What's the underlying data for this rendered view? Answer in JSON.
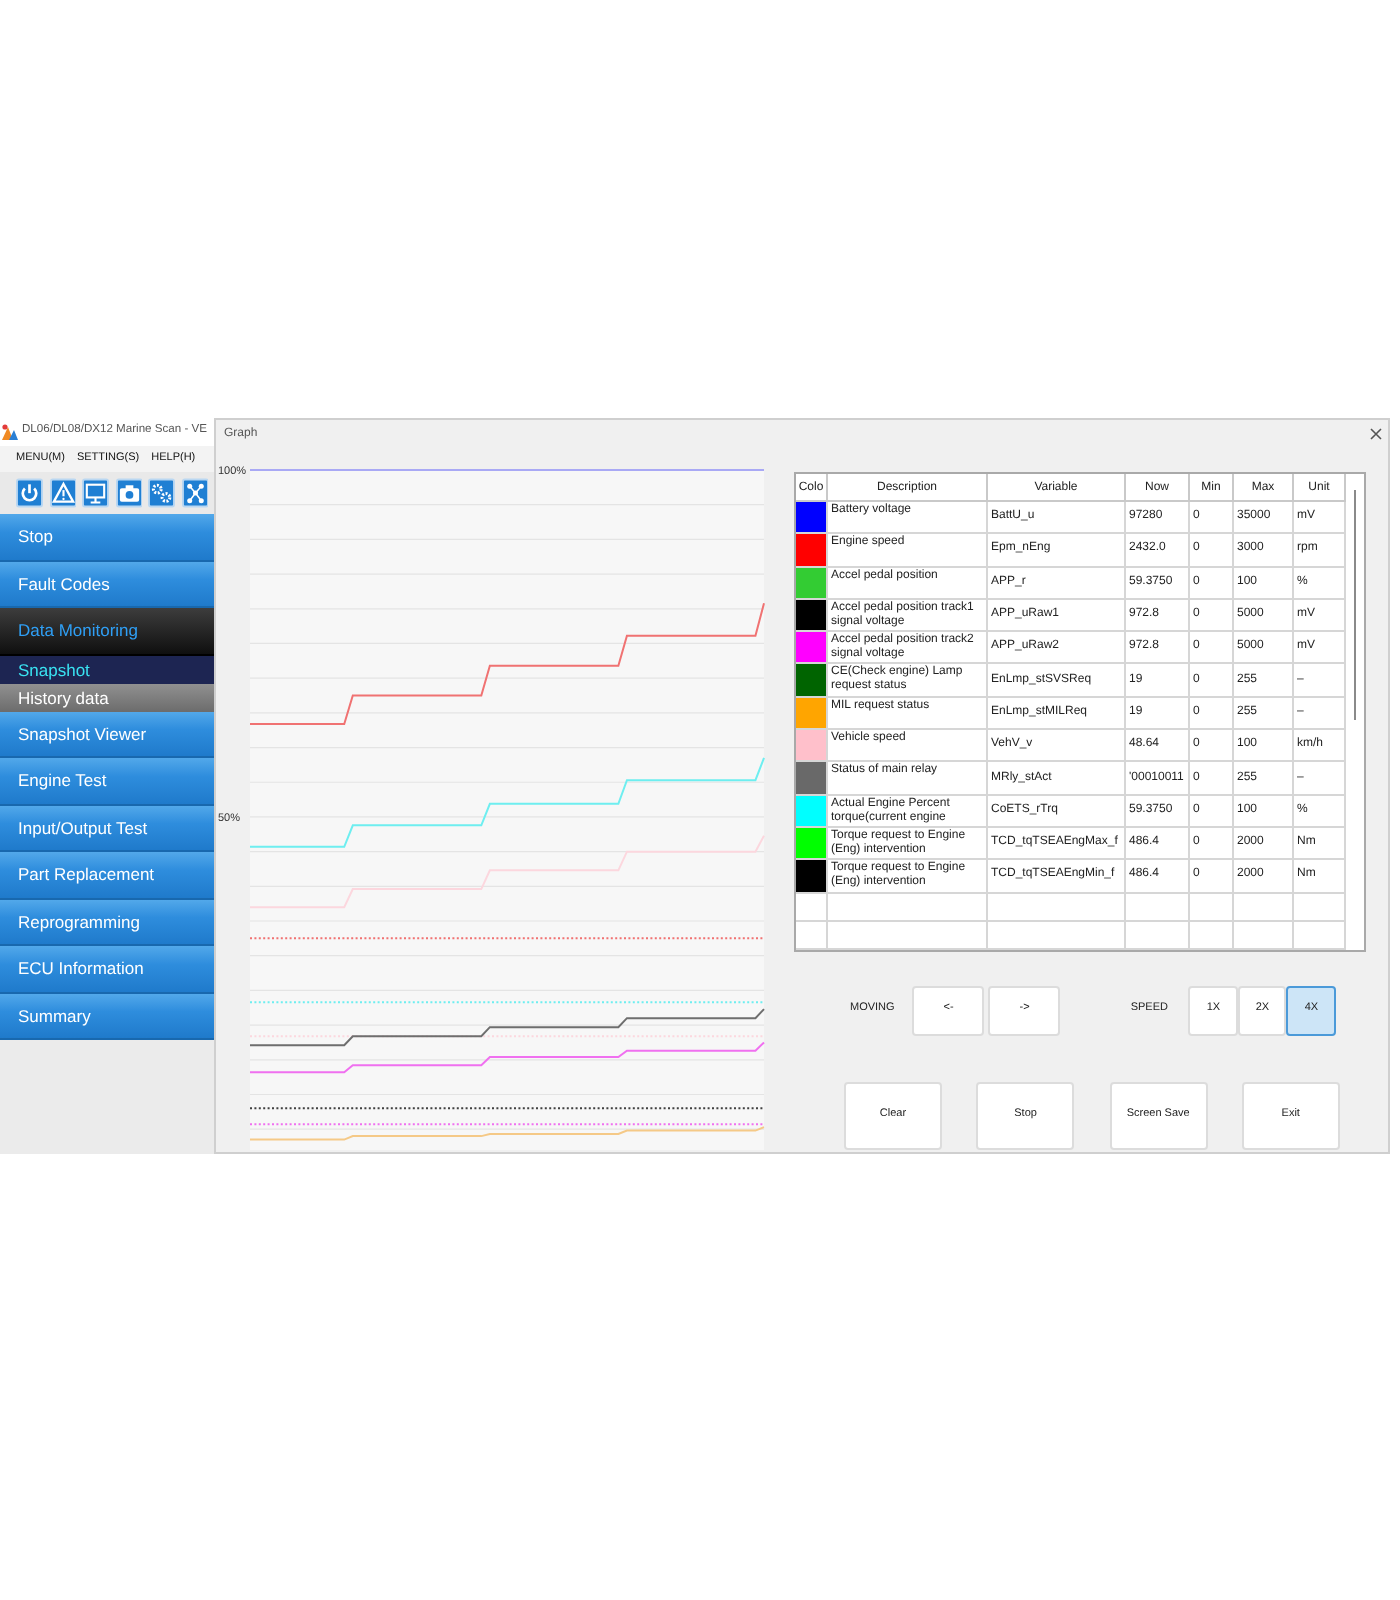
{
  "main_window": {
    "title": "DL06/DL08/DX12 Marine Scan - VE",
    "menu": [
      "MENU(M)",
      "SETTING(S)",
      "HELP(H)"
    ]
  },
  "sidebar": {
    "items": [
      {
        "label": "Stop",
        "selected": false
      },
      {
        "label": "Fault Codes",
        "selected": false
      },
      {
        "label": "Data Monitoring",
        "selected": true,
        "children": [
          {
            "label": "Snapshot",
            "selected": true
          },
          {
            "label": "History data",
            "selected": false
          }
        ]
      },
      {
        "label": "Snapshot Viewer",
        "selected": false
      },
      {
        "label": "Engine Test",
        "selected": false
      },
      {
        "label": "Input/Output Test",
        "selected": false
      },
      {
        "label": "Part Replacement",
        "selected": false
      },
      {
        "label": "Reprogramming",
        "selected": false
      },
      {
        "label": "ECU Information",
        "selected": false
      },
      {
        "label": "Summary",
        "selected": false
      }
    ]
  },
  "graph_window": {
    "title": "Graph"
  },
  "chart": {
    "chart_data": {
      "type": "line",
      "categories": [
        null,
        null,
        null,
        null,
        null,
        null,
        null,
        null,
        null,
        null,
        null,
        null,
        null,
        null,
        null,
        null,
        null,
        null,
        null,
        null,
        null,
        null,
        null,
        null,
        null,
        null,
        null,
        null,
        null,
        null,
        null,
        null,
        null,
        null,
        null,
        null,
        null,
        null,
        null,
        null,
        null,
        null,
        null,
        null,
        null,
        null,
        null,
        null,
        null,
        null,
        null,
        null,
        null,
        null,
        null,
        null,
        null,
        null,
        null,
        null,
        null
      ],
      "ylim": [
        2,
        100
      ],
      "yticks": [
        {
          "value": 50,
          "label": "50%"
        },
        {
          "value": 100,
          "label": "100%"
        }
      ],
      "series": [
        {
          "color": "#a9a9f5",
          "line_style": "solid",
          "values": [
            100,
            100,
            100,
            100,
            100,
            100,
            100,
            100,
            100,
            100,
            100,
            100,
            100,
            100,
            100,
            100,
            100,
            100,
            100,
            100,
            100,
            100,
            100,
            100,
            100,
            100,
            100,
            100,
            100,
            100,
            100,
            100,
            100,
            100,
            100,
            100,
            100,
            100,
            100,
            100,
            100,
            100,
            100,
            100,
            100,
            100,
            100,
            100,
            100,
            100,
            100,
            100,
            100,
            100,
            100,
            100,
            100,
            100,
            100,
            100,
            100
          ]
        },
        {
          "color": "#f07272",
          "line_style": "solid",
          "values": [
            63.4,
            63.4,
            63.4,
            63.4,
            63.4,
            63.4,
            63.4,
            63.4,
            63.4,
            63.4,
            63.4,
            63.4,
            67.5,
            67.5,
            67.5,
            67.5,
            67.5,
            67.5,
            67.5,
            67.5,
            67.5,
            67.5,
            67.5,
            67.5,
            67.5,
            67.5,
            67.5,
            67.5,
            71.8,
            71.8,
            71.8,
            71.8,
            71.8,
            71.8,
            71.8,
            71.8,
            71.8,
            71.8,
            71.8,
            71.8,
            71.8,
            71.8,
            71.8,
            71.8,
            76.1,
            76.1,
            76.1,
            76.1,
            76.1,
            76.1,
            76.1,
            76.1,
            76.1,
            76.1,
            76.1,
            76.1,
            76.1,
            76.1,
            76.1,
            76.1,
            80.8
          ]
        },
        {
          "color": "#6eeef0",
          "line_style": "solid",
          "values": [
            45.7,
            45.7,
            45.7,
            45.7,
            45.7,
            45.7,
            45.7,
            45.7,
            45.7,
            45.7,
            45.7,
            45.7,
            48.8,
            48.8,
            48.8,
            48.8,
            48.8,
            48.8,
            48.8,
            48.8,
            48.8,
            48.8,
            48.8,
            48.8,
            48.8,
            48.8,
            48.8,
            48.8,
            51.9,
            51.9,
            51.9,
            51.9,
            51.9,
            51.9,
            51.9,
            51.9,
            51.9,
            51.9,
            51.9,
            51.9,
            51.9,
            51.9,
            51.9,
            51.9,
            55.3,
            55.3,
            55.3,
            55.3,
            55.3,
            55.3,
            55.3,
            55.3,
            55.3,
            55.3,
            55.3,
            55.3,
            55.3,
            55.3,
            55.3,
            55.3,
            58.5
          ]
        },
        {
          "color": "#fcd7de",
          "line_style": "solid",
          "values": [
            37,
            37,
            37,
            37,
            37,
            37,
            37,
            37,
            37,
            37,
            37,
            37,
            39.6,
            39.6,
            39.6,
            39.6,
            39.6,
            39.6,
            39.6,
            39.6,
            39.6,
            39.6,
            39.6,
            39.6,
            39.6,
            39.6,
            39.6,
            39.6,
            42.3,
            42.3,
            42.3,
            42.3,
            42.3,
            42.3,
            42.3,
            42.3,
            42.3,
            42.3,
            42.3,
            42.3,
            42.3,
            42.3,
            42.3,
            42.3,
            45,
            45,
            45,
            45,
            45,
            45,
            45,
            45,
            45,
            45,
            45,
            45,
            45,
            45,
            45,
            45,
            47.3
          ]
        },
        {
          "color": "#f07272",
          "line_style": "dotted",
          "values": [
            32.5,
            32.5,
            32.5,
            32.5,
            32.5,
            32.5,
            32.5,
            32.5,
            32.5,
            32.5,
            32.5,
            32.5,
            32.5,
            32.5,
            32.5,
            32.5,
            32.5,
            32.5,
            32.5,
            32.5,
            32.5,
            32.5,
            32.5,
            32.5,
            32.5,
            32.5,
            32.5,
            32.5,
            32.5,
            32.5,
            32.5,
            32.5,
            32.5,
            32.5,
            32.5,
            32.5,
            32.5,
            32.5,
            32.5,
            32.5,
            32.5,
            32.5,
            32.5,
            32.5,
            32.5,
            32.5,
            32.5,
            32.5,
            32.5,
            32.5,
            32.5,
            32.5,
            32.5,
            32.5,
            32.5,
            32.5,
            32.5,
            32.5,
            32.5,
            32.5,
            32.5
          ]
        },
        {
          "color": "#6eeef0",
          "line_style": "dotted",
          "values": [
            23.3,
            23.3,
            23.3,
            23.3,
            23.3,
            23.3,
            23.3,
            23.3,
            23.3,
            23.3,
            23.3,
            23.3,
            23.3,
            23.3,
            23.3,
            23.3,
            23.3,
            23.3,
            23.3,
            23.3,
            23.3,
            23.3,
            23.3,
            23.3,
            23.3,
            23.3,
            23.3,
            23.3,
            23.3,
            23.3,
            23.3,
            23.3,
            23.3,
            23.3,
            23.3,
            23.3,
            23.3,
            23.3,
            23.3,
            23.3,
            23.3,
            23.3,
            23.3,
            23.3,
            23.3,
            23.3,
            23.3,
            23.3,
            23.3,
            23.3,
            23.3,
            23.3,
            23.3,
            23.3,
            23.3,
            23.3,
            23.3,
            23.3,
            23.3,
            23.3,
            23.3
          ]
        },
        {
          "color": "#fcd7de",
          "line_style": "dotted",
          "values": [
            18.4,
            18.4,
            18.4,
            18.4,
            18.4,
            18.4,
            18.4,
            18.4,
            18.4,
            18.4,
            18.4,
            18.4,
            18.4,
            18.4,
            18.4,
            18.4,
            18.4,
            18.4,
            18.4,
            18.4,
            18.4,
            18.4,
            18.4,
            18.4,
            18.4,
            18.4,
            18.4,
            18.4,
            18.4,
            18.4,
            18.4,
            18.4,
            18.4,
            18.4,
            18.4,
            18.4,
            18.4,
            18.4,
            18.4,
            18.4,
            18.4,
            18.4,
            18.4,
            18.4,
            18.4,
            18.4,
            18.4,
            18.4,
            18.4,
            18.4,
            18.4,
            18.4,
            18.4,
            18.4,
            18.4,
            18.4,
            18.4,
            18.4,
            18.4,
            18.4,
            18.4
          ]
        },
        {
          "color": "#6e6e6e",
          "line_style": "solid",
          "values": [
            17.1,
            17.1,
            17.1,
            17.1,
            17.1,
            17.1,
            17.1,
            17.1,
            17.1,
            17.1,
            17.1,
            17.1,
            18.4,
            18.4,
            18.4,
            18.4,
            18.4,
            18.4,
            18.4,
            18.4,
            18.4,
            18.4,
            18.4,
            18.4,
            18.4,
            18.4,
            18.4,
            18.4,
            19.7,
            19.7,
            19.7,
            19.7,
            19.7,
            19.7,
            19.7,
            19.7,
            19.7,
            19.7,
            19.7,
            19.7,
            19.7,
            19.7,
            19.7,
            19.7,
            21,
            21,
            21,
            21,
            21,
            21,
            21,
            21,
            21,
            21,
            21,
            21,
            21,
            21,
            21,
            21,
            22.3
          ]
        },
        {
          "color": "#f070f0",
          "line_style": "solid",
          "values": [
            13.2,
            13.2,
            13.2,
            13.2,
            13.2,
            13.2,
            13.2,
            13.2,
            13.2,
            13.2,
            13.2,
            13.2,
            14.2,
            14.2,
            14.2,
            14.2,
            14.2,
            14.2,
            14.2,
            14.2,
            14.2,
            14.2,
            14.2,
            14.2,
            14.2,
            14.2,
            14.2,
            14.2,
            15.4,
            15.4,
            15.4,
            15.4,
            15.4,
            15.4,
            15.4,
            15.4,
            15.4,
            15.4,
            15.4,
            15.4,
            15.4,
            15.4,
            15.4,
            15.4,
            16.3,
            16.3,
            16.3,
            16.3,
            16.3,
            16.3,
            16.3,
            16.3,
            16.3,
            16.3,
            16.3,
            16.3,
            16.3,
            16.3,
            16.3,
            16.3,
            17.5
          ]
        },
        {
          "color": "#404040",
          "line_style": "dotted",
          "values": [
            8,
            8,
            8,
            8,
            8,
            8,
            8,
            8,
            8,
            8,
            8,
            8,
            8,
            8,
            8,
            8,
            8,
            8,
            8,
            8,
            8,
            8,
            8,
            8,
            8,
            8,
            8,
            8,
            8,
            8,
            8,
            8,
            8,
            8,
            8,
            8,
            8,
            8,
            8,
            8,
            8,
            8,
            8,
            8,
            8,
            8,
            8,
            8,
            8,
            8,
            8,
            8,
            8,
            8,
            8,
            8,
            8,
            8,
            8,
            8,
            8
          ]
        },
        {
          "color": "#f070f0",
          "line_style": "dotted",
          "values": [
            5.7,
            5.7,
            5.7,
            5.7,
            5.7,
            5.7,
            5.7,
            5.7,
            5.7,
            5.7,
            5.7,
            5.7,
            5.7,
            5.7,
            5.7,
            5.7,
            5.7,
            5.7,
            5.7,
            5.7,
            5.7,
            5.7,
            5.7,
            5.7,
            5.7,
            5.7,
            5.7,
            5.7,
            5.7,
            5.7,
            5.7,
            5.7,
            5.7,
            5.7,
            5.7,
            5.7,
            5.7,
            5.7,
            5.7,
            5.7,
            5.7,
            5.7,
            5.7,
            5.7,
            5.7,
            5.7,
            5.7,
            5.7,
            5.7,
            5.7,
            5.7,
            5.7,
            5.7,
            5.7,
            5.7,
            5.7,
            5.7,
            5.7,
            5.7,
            5.7,
            5.7
          ]
        },
        {
          "color": "#f5c987",
          "line_style": "solid",
          "values": [
            3.5,
            3.5,
            3.5,
            3.5,
            3.5,
            3.5,
            3.5,
            3.5,
            3.5,
            3.5,
            3.5,
            3.5,
            4,
            4,
            4,
            4,
            4,
            4,
            4,
            4,
            4,
            4,
            4,
            4,
            4,
            4,
            4,
            4,
            4.3,
            4.3,
            4.3,
            4.3,
            4.3,
            4.3,
            4.3,
            4.3,
            4.3,
            4.3,
            4.3,
            4.3,
            4.3,
            4.3,
            4.3,
            4.3,
            4.8,
            4.8,
            4.8,
            4.8,
            4.8,
            4.8,
            4.8,
            4.8,
            4.8,
            4.8,
            4.8,
            4.8,
            4.8,
            4.8,
            4.8,
            4.8,
            5.3
          ]
        }
      ]
    }
  },
  "table": {
    "columns": [
      "Colo",
      "Description",
      "Variable",
      "Now",
      "Min",
      "Max",
      "Unit"
    ],
    "rows": [
      {
        "color": "#0000ff",
        "description": "Battery voltage",
        "variable": "BattU_u",
        "now": "97280",
        "min": "0",
        "max": "35000",
        "unit": "mV"
      },
      {
        "color": "#ff0000",
        "description": "Engine speed",
        "variable": "Epm_nEng",
        "now": "2432.0",
        "min": "0",
        "max": "3000",
        "unit": "rpm"
      },
      {
        "color": "#33cc33",
        "description": "Accel pedal position",
        "variable": "APP_r",
        "now": "59.3750",
        "min": "0",
        "max": "100",
        "unit": "%"
      },
      {
        "color": "#000000",
        "description": "Accel pedal position track1 signal voltage",
        "variable": "APP_uRaw1",
        "now": "972.8",
        "min": "0",
        "max": "5000",
        "unit": "mV"
      },
      {
        "color": "#ff00ff",
        "description": "Accel pedal position track2 signal voltage",
        "variable": "APP_uRaw2",
        "now": "972.8",
        "min": "0",
        "max": "5000",
        "unit": "mV"
      },
      {
        "color": "#006400",
        "description": "CE(Check engine) Lamp request status",
        "variable": "EnLmp_stSVSReq",
        "now": "19",
        "min": "0",
        "max": "255",
        "unit": "–"
      },
      {
        "color": "#ffa500",
        "description": "MIL request status",
        "variable": "EnLmp_stMILReq",
        "now": "19",
        "min": "0",
        "max": "255",
        "unit": "–"
      },
      {
        "color": "#ffc0cb",
        "description": "Vehicle speed",
        "variable": "VehV_v",
        "now": "48.64",
        "min": "0",
        "max": "100",
        "unit": "km/h"
      },
      {
        "color": "#696969",
        "description": "Status of main relay",
        "variable": "MRly_stAct",
        "now": "'00010011",
        "min": "0",
        "max": "255",
        "unit": "–"
      },
      {
        "color": "#00ffff",
        "description": "Actual Engine Percent torque(current engine",
        "variable": "CoETS_rTrq",
        "now": "59.3750",
        "min": "0",
        "max": "100",
        "unit": "%"
      },
      {
        "color": "#00ff00",
        "description": "Torque request to Engine (Eng) intervention",
        "variable": "TCD_tqTSEAEngMax_f",
        "now": "486.4",
        "min": "0",
        "max": "2000",
        "unit": "Nm"
      },
      {
        "color": "#000000",
        "description": "Torque request to Engine (Eng) intervention",
        "variable": "TCD_tqTSEAEngMin_f",
        "now": "486.4",
        "min": "0",
        "max": "2000",
        "unit": "Nm"
      }
    ]
  },
  "moving": {
    "label": "MOVING",
    "buttons": [
      "<-",
      "->"
    ]
  },
  "speed": {
    "label": "SPEED",
    "options": [
      {
        "label": "1X",
        "selected": false
      },
      {
        "label": "2X",
        "selected": false
      },
      {
        "label": "4X",
        "selected": true
      }
    ]
  },
  "buttons": [
    "Clear",
    "Stop",
    "Screen Save",
    "Exit"
  ]
}
